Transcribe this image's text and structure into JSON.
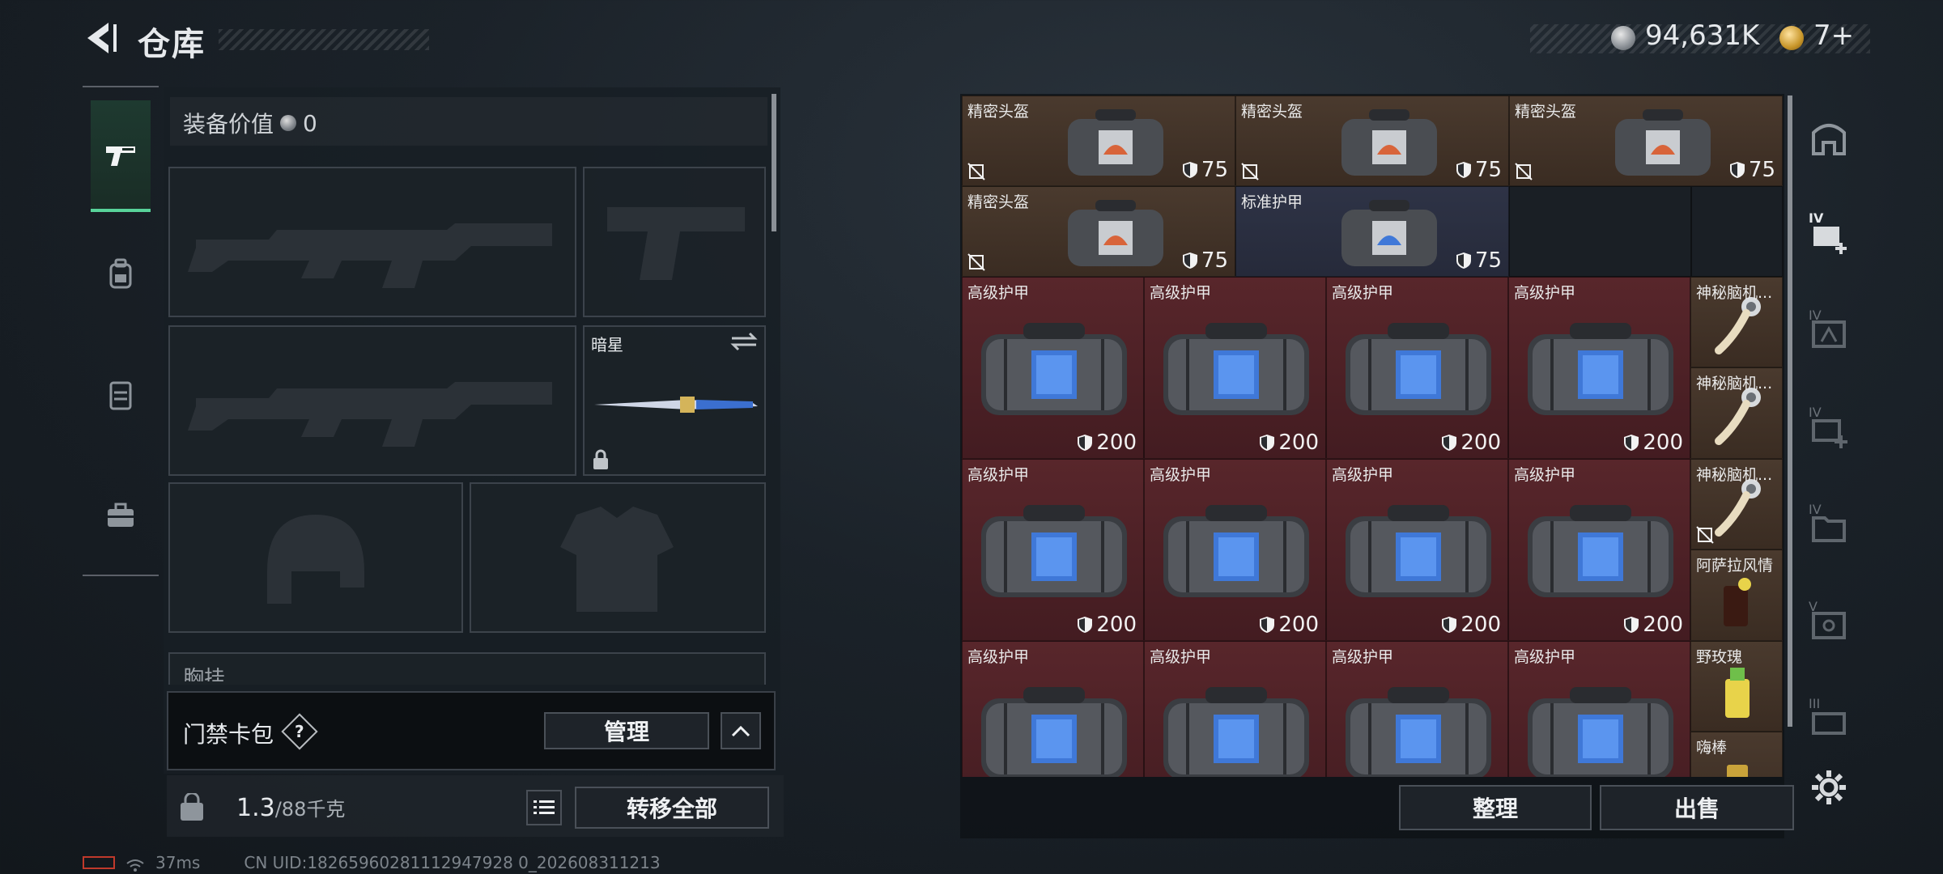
{
  "header": {
    "title": "仓库",
    "currency_silver": "94,631K",
    "currency_gold": "7+"
  },
  "equipment": {
    "value_label": "装备价值",
    "value": "0",
    "knife_name": "暗星",
    "chest_label": "胸挂",
    "access_label": "门禁卡包",
    "access_help": "?",
    "manage_label": "管理",
    "weight_current": "1.3",
    "weight_max": "/88千克",
    "transfer_all_label": "转移全部"
  },
  "inventory": {
    "items": [
      {
        "name": "精密头盔",
        "dur": "75",
        "bg": "brown",
        "kind": "helmet-bag",
        "nobind": true
      },
      {
        "name": "精密头盔",
        "dur": "75",
        "bg": "brown",
        "kind": "helmet-bag",
        "nobind": true
      },
      {
        "name": "精密头盔",
        "dur": "75",
        "bg": "brown",
        "kind": "helmet-bag",
        "nobind": true
      },
      {
        "name": "精密头盔",
        "dur": "75",
        "bg": "brown",
        "kind": "helmet-bag",
        "nobind": true
      },
      {
        "name": "标准护甲",
        "dur": "75",
        "bg": "blue",
        "kind": "armor-small",
        "nobind": false
      },
      {
        "name": "高级护甲",
        "dur": "200",
        "bg": "red",
        "kind": "armor-big"
      },
      {
        "name": "高级护甲",
        "dur": "200",
        "bg": "red",
        "kind": "armor-big"
      },
      {
        "name": "高级护甲",
        "dur": "200",
        "bg": "red",
        "kind": "armor-big"
      },
      {
        "name": "高级护甲",
        "dur": "200",
        "bg": "red",
        "kind": "armor-big"
      },
      {
        "name": "神秘脑机...",
        "dur": "",
        "bg": "brown",
        "kind": "cable"
      },
      {
        "name": "神秘脑机...",
        "dur": "",
        "bg": "brown",
        "kind": "cable"
      },
      {
        "name": "高级护甲",
        "dur": "200",
        "bg": "red",
        "kind": "armor-big"
      },
      {
        "name": "高级护甲",
        "dur": "200",
        "bg": "red",
        "kind": "armor-big"
      },
      {
        "name": "高级护甲",
        "dur": "200",
        "bg": "red",
        "kind": "armor-big"
      },
      {
        "name": "高级护甲",
        "dur": "200",
        "bg": "red",
        "kind": "armor-big"
      },
      {
        "name": "神秘脑机...",
        "dur": "",
        "bg": "brown",
        "kind": "cable",
        "nobind": true
      },
      {
        "name": "阿萨拉风情",
        "dur": "",
        "bg": "brown",
        "kind": "drink"
      },
      {
        "name": "高级护甲",
        "dur": "",
        "bg": "red",
        "kind": "armor-big"
      },
      {
        "name": "高级护甲",
        "dur": "",
        "bg": "red",
        "kind": "armor-big"
      },
      {
        "name": "高级护甲",
        "dur": "",
        "bg": "red",
        "kind": "armor-big"
      },
      {
        "name": "高级护甲",
        "dur": "",
        "bg": "red",
        "kind": "armor-big"
      },
      {
        "name": "野玫瑰",
        "dur": "",
        "bg": "brown",
        "kind": "cocktail"
      },
      {
        "name": "嗨棒",
        "dur": "",
        "bg": "brown",
        "kind": "drink2"
      }
    ],
    "sort_label": "整理",
    "sell_label": "出售"
  },
  "rail": {
    "labels": [
      "IV",
      "IV",
      "IV",
      "IV",
      "V",
      "III"
    ]
  },
  "status": {
    "ping": "37ms",
    "uid": "CN UID:18265960281112947928 0_202608311213"
  }
}
